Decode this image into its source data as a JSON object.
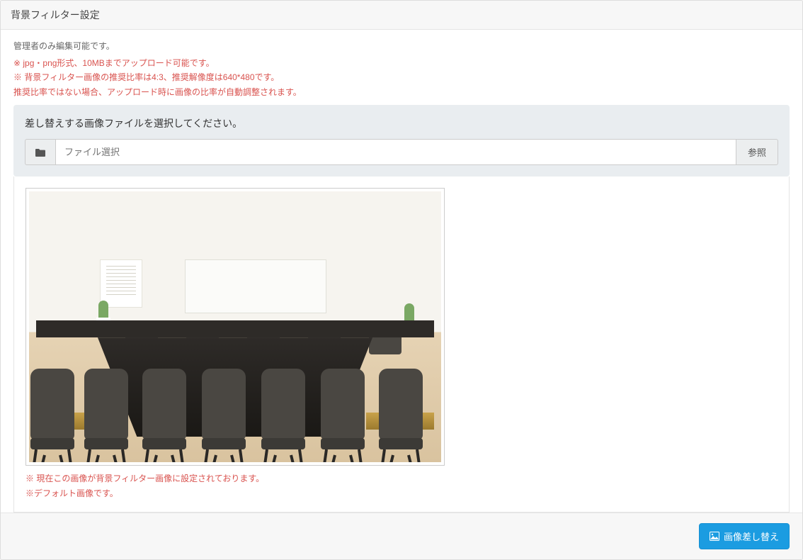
{
  "header": {
    "title": "背景フィルター設定"
  },
  "notes": {
    "admin_only": "管理者のみ編集可能です。",
    "upload_format": "※ jpg・png形式、10MBまでアップロード可能です。",
    "ratio": "※ 背景フィルター画像の推奨比率は4:3、推奨解像度は640*480です。",
    "auto_adjust": "推奨比率ではない場合、アップロード時に画像の比率が自動調整されます。"
  },
  "upload": {
    "section_title": "差し替えする画像ファイルを選択してください。",
    "placeholder": "ファイル選択",
    "browse_label": "参照"
  },
  "preview": {
    "current_note": "※ 現在この画像が背景フィルター画像に設定されております。",
    "default_note": "※デフォルト画像です。"
  },
  "footer": {
    "replace_button": "画像差し替え"
  }
}
